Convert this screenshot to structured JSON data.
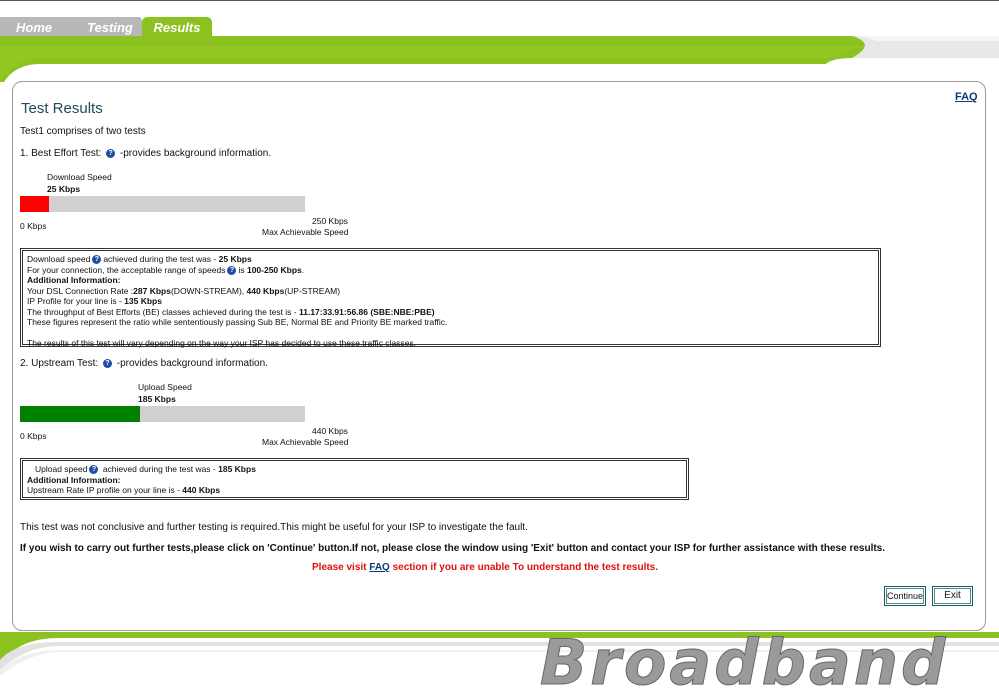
{
  "nav": {
    "tabs": [
      {
        "label": "Home"
      },
      {
        "label": "Testing"
      },
      {
        "label": "Results"
      }
    ]
  },
  "page": {
    "title": "Test Results",
    "faq_link": "FAQ",
    "intro": "Test1 comprises of two tests"
  },
  "tests": {
    "best_effort": {
      "heading": "1. Best Effort Test:",
      "help_text": "-provides background information.",
      "bar_label": "Download Speed",
      "bar_value": "25 Kbps",
      "min_label": "0 Kbps",
      "max_value": "250 Kbps",
      "max_caption": "Max Achievable Speed",
      "fill_fraction": 0.1,
      "fill_color": "#ff0000",
      "info": {
        "line1_a": "Download speed",
        "line1_b": "achieved during the test was - ",
        "line1_val": "25 Kbps",
        "line2_a": "For your connection, the acceptable range of speeds",
        "line2_b": "is ",
        "line2_val": "100-250 Kbps",
        "line2_end": ".",
        "additional": "Additional Information:",
        "line3_a": "Your DSL Connection Rate :",
        "line3_down": "287 Kbps",
        "line3_down_label": "(DOWN-STREAM), ",
        "line3_up": "440 Kbps",
        "line3_up_label": "(UP-STREAM)",
        "line4_a": "IP Profile for your line is - ",
        "line4_val": "135 Kbps",
        "line5_a": "The throughput of Best Efforts (BE) classes achieved during the test is - ",
        "line5_val": "11.17:33.91:56.86 (SBE:NBE:PBE)",
        "line6": "These figures represent the ratio while sententiously passing Sub BE, Normal BE and Priority BE marked traffic.",
        "line7": "The results of this test will vary depending on the way your ISP has decided to use these traffic classes."
      }
    },
    "upstream": {
      "heading": "2. Upstream Test:",
      "help_text": "-provides background information.",
      "bar_label": "Upload Speed",
      "bar_value": "185 Kbps",
      "min_label": "0 Kbps",
      "max_value": "440 Kbps",
      "max_caption": "Max Achievable Speed",
      "fill_fraction": 0.42,
      "fill_color": "#008000",
      "info": {
        "line1_a": "Upload speed",
        "line1_b": " achieved during the test was - ",
        "line1_val": "185 Kbps",
        "additional": "Additional Information:",
        "line2_a": "Upstream Rate IP profile on your line is - ",
        "line2_val": "440 Kbps"
      }
    }
  },
  "messages": {
    "inconclusive": "This test was not conclusive and further testing is required.This might be useful for your ISP to investigate the fault.",
    "instruction": "If you wish to carry out further tests,please click on 'Continue' button.If not, please close the window using 'Exit' button and contact your ISP for further assistance with these results.",
    "faq_prefix": "Please visit ",
    "faq_link": "FAQ",
    "faq_suffix": " section if you are unable To understand the test results."
  },
  "buttons": {
    "continue": "Continue",
    "exit": "Exit"
  },
  "brand": {
    "logo_text": "Broadband"
  },
  "colors": {
    "accent_green": "#8cc21f",
    "tab_grey": "#b8b8b8",
    "title": "#1f4a5a",
    "link": "#0b3a6e",
    "alert_red": "#e01010"
  }
}
